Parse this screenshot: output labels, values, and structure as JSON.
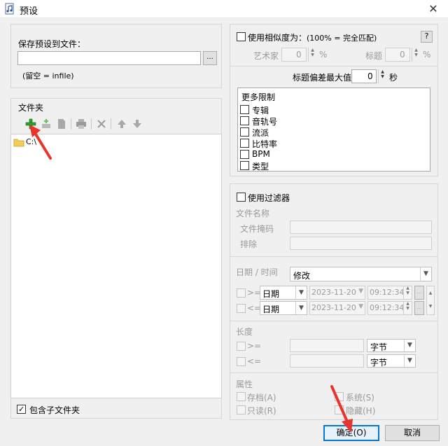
{
  "window": {
    "title": "预设",
    "close_icon": "✕"
  },
  "left": {
    "save_label": "保存预设到文件：",
    "save_value": "",
    "browse_label": "...",
    "hint": "(留空 = infile)",
    "folders_label": "文件夹",
    "folder_items": [
      "C:\\"
    ],
    "include_subfolders": "包含子文件夹"
  },
  "right": {
    "similarity_label": "使用相似度为：",
    "similarity_note": "(100% = 完全匹配)",
    "help": "?",
    "artist_label": "艺术家",
    "artist_value": "0",
    "title_label": "标题",
    "title_value": "0",
    "percent": "%",
    "tolerance_label": "标题偏差最大值",
    "tolerance_value": "0",
    "tolerance_unit": "秒",
    "more_limits": "更多限制",
    "limits": [
      "专辑",
      "音轨号",
      "流派",
      "比特率",
      "BPM",
      "类型"
    ],
    "filter_label": "使用过滤器",
    "filename_label": "文件名称",
    "mask_label": "文件掩码",
    "exclude_label": "排除",
    "datetime_label": "日期 / 时间",
    "datetime_mode": "修改",
    "ge": ">=",
    "le": "<=",
    "date_type": "日期",
    "date_value": "2023-11-20",
    "time_value": "09:12:34",
    "length_label": "长度",
    "unit": "字节",
    "attributes_label": "属性",
    "attr_archive": "存档(A)",
    "attr_system": "系统(S)",
    "attr_readonly": "只读(R)",
    "attr_hidden": "隐藏(H)"
  },
  "buttons": {
    "ok": "确定(O)",
    "cancel": "取消"
  },
  "colors": {
    "arrow": "#e8342a",
    "accent": "#0078d7",
    "add_green": "#2aa32a"
  }
}
